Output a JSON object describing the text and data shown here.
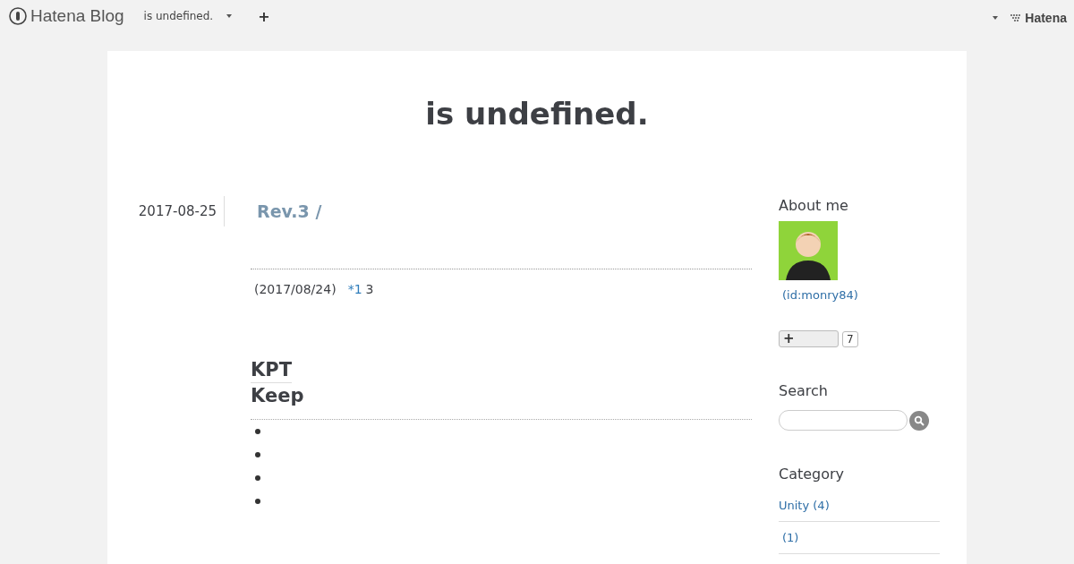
{
  "top_bar": {
    "logo": "Hatena Blog",
    "blog_name": "is undefined.",
    "add_button": "+",
    "brand": "Hatena"
  },
  "blog_title": "is undefined.",
  "entry": {
    "date": "2017-08-25",
    "title": "Rev.3 /",
    "meta": "(2017/08/24)",
    "footnote": "*1",
    "meta_after": "3",
    "headings": [
      {
        "kind": "h3",
        "text": "KPT"
      },
      {
        "kind": "h4",
        "text": "Keep"
      }
    ],
    "bullets": [
      {
        "kind": "empty"
      },
      {
        "kind": "empty"
      },
      {
        "kind": "empty"
      },
      {
        "kind": "empty"
      }
    ]
  },
  "sidebar": {
    "about": {
      "title": "About me",
      "user_id": "(id:monry84)",
      "subscribe_button": "+",
      "subscribe_count": "7"
    },
    "search": {
      "title": "Search"
    },
    "category": {
      "title": "Category",
      "items": [
        "Unity (4)",
        "(1)"
      ]
    }
  }
}
